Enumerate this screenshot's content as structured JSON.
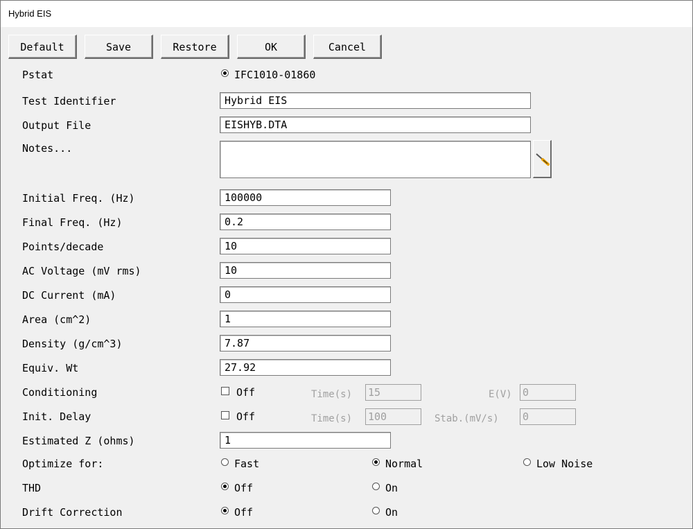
{
  "window": {
    "title": "Hybrid EIS"
  },
  "toolbar": {
    "default_label": "Default",
    "save_label": "Save",
    "restore_label": "Restore",
    "ok_label": "OK",
    "cancel_label": "Cancel"
  },
  "pstat": {
    "label": "Pstat",
    "value": "IFC1010-01860",
    "selected": true
  },
  "test_identifier": {
    "label": "Test Identifier",
    "value": "Hybrid EIS"
  },
  "output_file": {
    "label": "Output File",
    "value": "EISHYB.DTA"
  },
  "notes": {
    "label": "Notes...",
    "value": "",
    "edit_icon": "screwdriver-icon"
  },
  "initial_freq": {
    "label": "Initial Freq. (Hz)",
    "value": "100000"
  },
  "final_freq": {
    "label": "Final Freq. (Hz)",
    "value": "0.2"
  },
  "points_decade": {
    "label": "Points/decade",
    "value": "10"
  },
  "ac_voltage": {
    "label": "AC Voltage (mV rms)",
    "value": "10"
  },
  "dc_current": {
    "label": "DC Current (mA)",
    "value": "0"
  },
  "area": {
    "label": "Area (cm^2)",
    "value": "1"
  },
  "density": {
    "label": "Density (g/cm^3)",
    "value": "7.87"
  },
  "equiv_wt": {
    "label": "Equiv. Wt",
    "value": "27.92"
  },
  "conditioning": {
    "label": "Conditioning",
    "checkbox_label": "Off",
    "checked": false,
    "time_label": "Time(s)",
    "time_value": "15",
    "e_label": "E(V)",
    "e_value": "0"
  },
  "init_delay": {
    "label": "Init. Delay",
    "checkbox_label": "Off",
    "checked": false,
    "time_label": "Time(s)",
    "time_value": "100",
    "stab_label": "Stab.(mV/s)",
    "stab_value": "0"
  },
  "estimated_z": {
    "label": "Estimated Z (ohms)",
    "value": "1"
  },
  "optimize": {
    "label": "Optimize for:",
    "options": [
      "Fast",
      "Normal",
      "Low Noise"
    ],
    "selected": "Normal"
  },
  "thd": {
    "label": "THD",
    "options": [
      "Off",
      "On"
    ],
    "selected": "Off"
  },
  "drift": {
    "label": "Drift Correction",
    "options": [
      "Off",
      "On"
    ],
    "selected": "Off"
  }
}
